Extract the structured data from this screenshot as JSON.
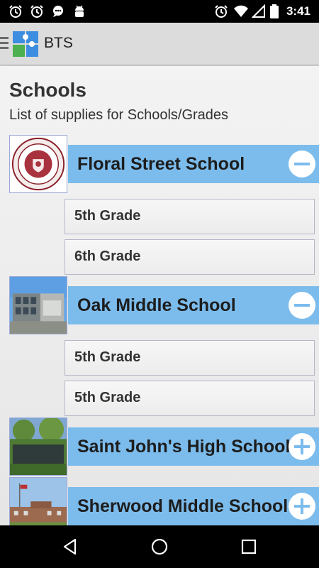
{
  "status_bar": {
    "time": "3:41",
    "left_icons": [
      "alarm-icon",
      "alarm-icon",
      "chat-icon",
      "android-icon"
    ],
    "right_icons": [
      "alarm-icon",
      "wifi-icon",
      "signal-icon",
      "battery-icon"
    ]
  },
  "app_bar": {
    "title": "BTS",
    "logo": "puzzle-logo-icon"
  },
  "header": {
    "title": "Schools",
    "subtitle": "List of supplies for Schools/Grades"
  },
  "schools": [
    {
      "name": "Floral Street School",
      "expanded": true,
      "toggle_icon": "minus-circle-icon",
      "grades": [
        "5th Grade",
        "6th Grade"
      ]
    },
    {
      "name": "Oak Middle School",
      "expanded": true,
      "toggle_icon": "minus-circle-icon",
      "grades": [
        "5th Grade",
        "5th Grade"
      ]
    },
    {
      "name": "Saint John's High School",
      "expanded": false,
      "toggle_icon": "plus-circle-icon",
      "grades": []
    },
    {
      "name": "Sherwood Middle School",
      "expanded": false,
      "toggle_icon": "plus-circle-icon",
      "grades": []
    }
  ],
  "nav_bar": {
    "buttons": [
      "back-icon",
      "home-icon",
      "recents-icon"
    ]
  },
  "colors": {
    "accent": "#7cbcec",
    "status_bar": "#000000",
    "app_bar": "#dcdcdc"
  }
}
